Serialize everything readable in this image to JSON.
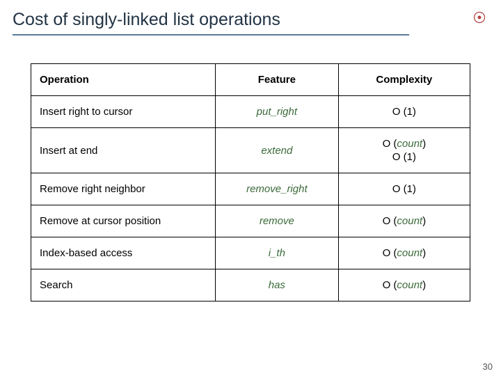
{
  "slide": {
    "title": "Cost of singly-linked list operations",
    "page_number": "30"
  },
  "table": {
    "headers": {
      "operation": "Operation",
      "feature": "Feature",
      "complexity": "Complexity"
    },
    "rows": [
      {
        "operation": "Insert right to cursor",
        "feature": "put_right",
        "complexity_html": "O (1)"
      },
      {
        "operation": "Insert at end",
        "feature": "extend",
        "complexity_html": "O (<em>count</em>)<span class='line2'>O (1)</span>",
        "twoLine": true
      },
      {
        "operation": "Remove right neighbor",
        "feature": "remove_right",
        "complexity_html": "O (1)"
      },
      {
        "operation": "Remove at cursor position",
        "feature": "remove",
        "complexity_html": "O (<em>count</em>)"
      },
      {
        "operation": "Index-based access",
        "feature": "i_th",
        "complexity_html": "O (<em>count</em>)"
      },
      {
        "operation": "Search",
        "feature": "has",
        "complexity_html": "O (<em>count</em>)"
      }
    ]
  }
}
